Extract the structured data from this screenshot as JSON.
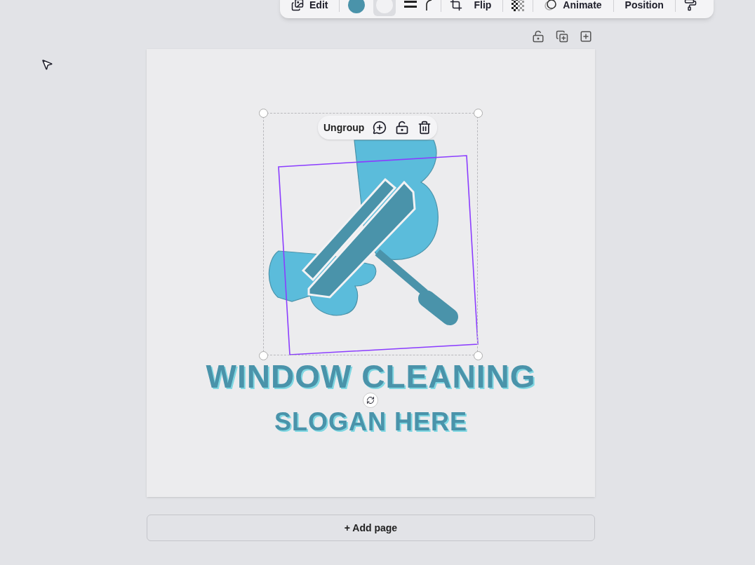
{
  "toolbar": {
    "edit_label": "Edit",
    "swatches": [
      {
        "color": "#4a93aa"
      },
      {
        "color": "#f2f2f4"
      }
    ],
    "flip_label": "Flip",
    "animate_label": "Animate",
    "position_label": "Position"
  },
  "selection_toolbar": {
    "ungroup_label": "Ungroup"
  },
  "design": {
    "title": "WINDOW CLEANING",
    "slogan": "SLOGAN HERE"
  },
  "add_page_label": "+ Add page"
}
